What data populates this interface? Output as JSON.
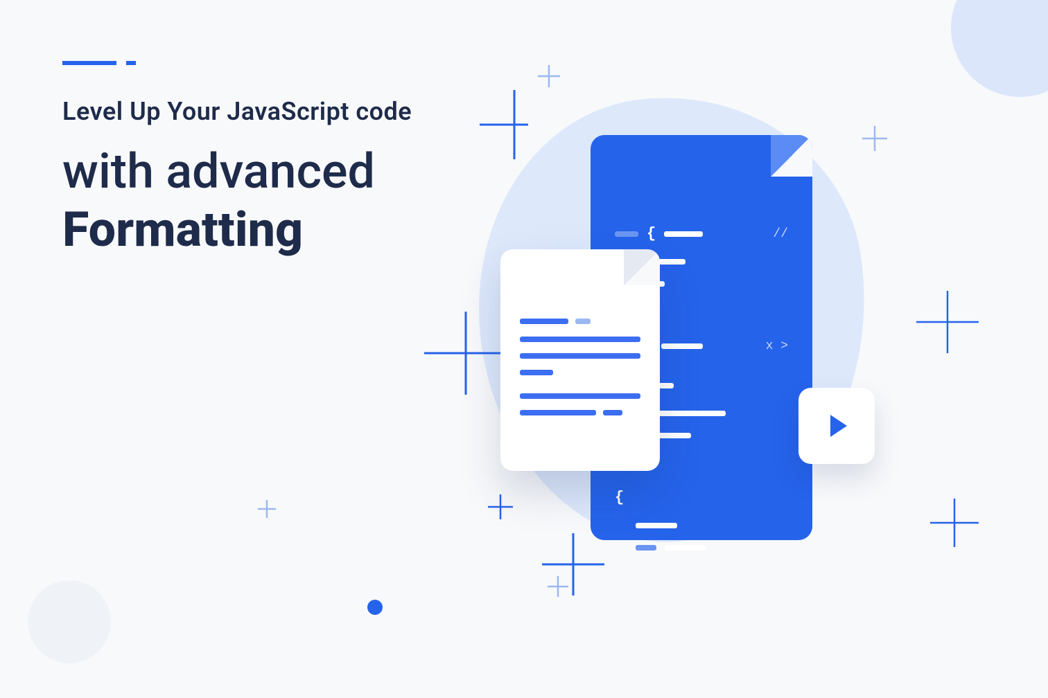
{
  "hero": {
    "line1": "Level Up Your JavaScript code",
    "line2": "with advanced",
    "line3": "Formatting"
  },
  "icons": {
    "play": "play-icon",
    "doc_white": "document-icon",
    "doc_blue": "code-file-icon"
  },
  "colors": {
    "primary": "#2563eb",
    "dark": "#1e2b4a",
    "soft": "#dde8fb"
  }
}
